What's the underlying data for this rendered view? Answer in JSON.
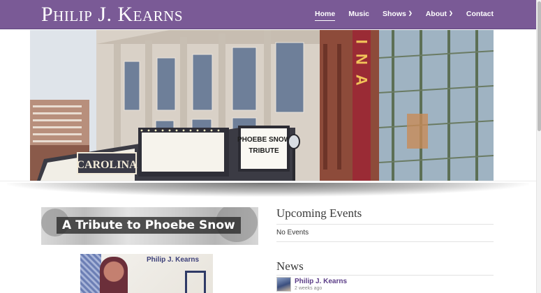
{
  "site": {
    "title": "Philip J. Kearns"
  },
  "nav": {
    "items": [
      {
        "label": "Home",
        "active": true,
        "has_dropdown": false
      },
      {
        "label": "Music",
        "active": false,
        "has_dropdown": false
      },
      {
        "label": "Shows",
        "active": false,
        "has_dropdown": true
      },
      {
        "label": "About",
        "active": false,
        "has_dropdown": true
      },
      {
        "label": "Contact",
        "active": false,
        "has_dropdown": false
      }
    ]
  },
  "hero": {
    "marquee_left": "CAROLINA",
    "marquee_sign_line1": "PHOEBE SNOW",
    "marquee_sign_line2": "TRIBUTE",
    "vertical_sign": "LINA"
  },
  "left": {
    "banner_text": "A Tribute to Phoebe Snow",
    "album_name": "Philip J. Kearns"
  },
  "events": {
    "heading": "Upcoming Events",
    "empty_text": "No Events"
  },
  "news": {
    "heading": "News",
    "author": "Philip J. Kearns",
    "time": "2 weeks ago"
  },
  "colors": {
    "header_bg": "#7a5a96",
    "link": "#5b3d87"
  },
  "icons": {
    "dropdown": "chevron-down-icon"
  }
}
